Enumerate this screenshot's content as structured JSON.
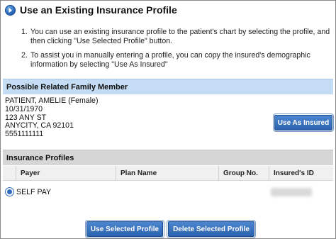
{
  "dialog": {
    "title": "Use an Existing Insurance Profile",
    "icon": "arrow-right-circle-icon",
    "accent_color": "#2d6bbf"
  },
  "instructions": [
    {
      "num": "1.",
      "text": "You can use an existing insurance profile to the patient's chart by selecting the profile, and then clicking \"Use Selected Profile\" button."
    },
    {
      "num": "2.",
      "text": "To assist you in manually entering a profile, you can copy the insured's demographic information by selecting \"Use As Insured\""
    }
  ],
  "family": {
    "header": "Possible Related Family Member",
    "name": "PATIENT, AMELIE (Female)",
    "dob": "10/31/1970",
    "address1": "123 ANY ST",
    "address2": "ANYCITY, CA 92101",
    "phone": "5551111111",
    "use_as_insured_label": "Use As Insured"
  },
  "profiles": {
    "header": "Insurance Profiles",
    "columns": [
      "Payer",
      "Plan Name",
      "Group No.",
      "Insured's ID"
    ],
    "rows": [
      {
        "payer": "SELF PAY",
        "plan_name": "",
        "group_no": "",
        "insured_id": "",
        "selected": true
      }
    ]
  },
  "actions": {
    "use_selected_label": "Use Selected Profile",
    "delete_selected_label": "Delete Selected Profile"
  }
}
